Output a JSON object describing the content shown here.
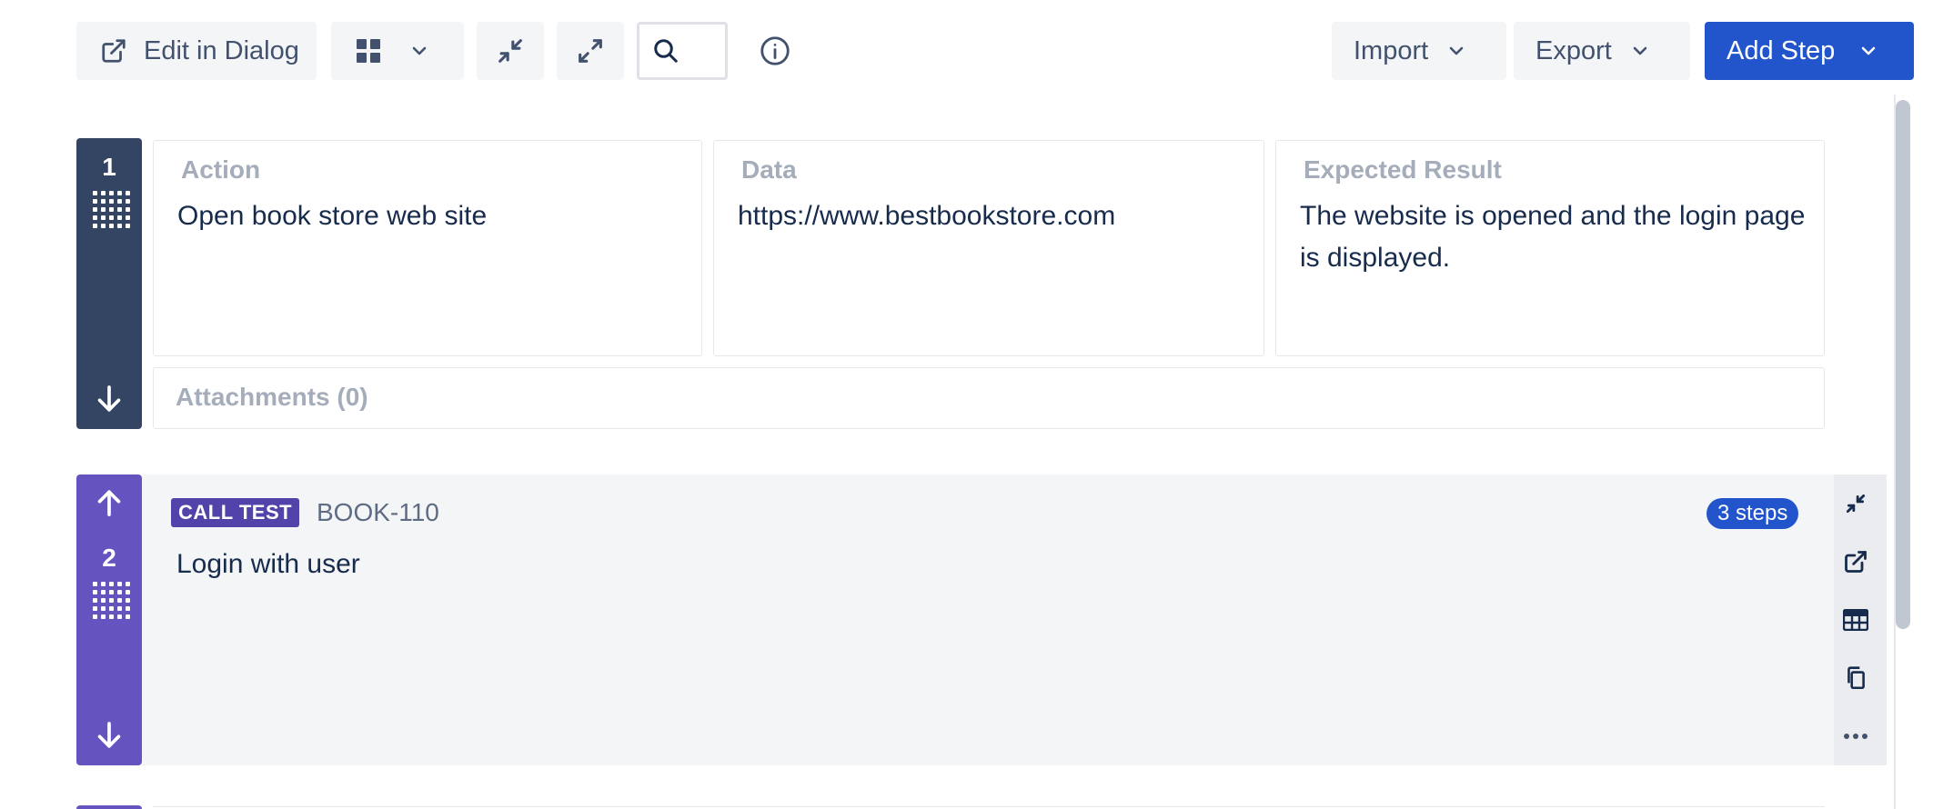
{
  "toolbar": {
    "edit_in_dialog": "Edit in Dialog",
    "import_label": "Import",
    "export_label": "Export",
    "add_step_label": "Add Step"
  },
  "steps": [
    {
      "number": "1",
      "action_header": "Action",
      "data_header": "Data",
      "expected_header": "Expected Result",
      "action": "Open book store web site",
      "data": "https://www.bestbookstore.com",
      "expected": "The website is opened and the login page is displayed.",
      "attachments": "Attachments (0)"
    },
    {
      "number": "2",
      "badge": "CALL TEST",
      "issue_key": "BOOK-110",
      "steps_count": "3 steps",
      "summary": "Login with user"
    }
  ],
  "colors": {
    "primary": "#2254cc",
    "step_bar_dark": "#344563",
    "call_test_purple": "#6554c0",
    "badge_purple": "#5243aa"
  }
}
